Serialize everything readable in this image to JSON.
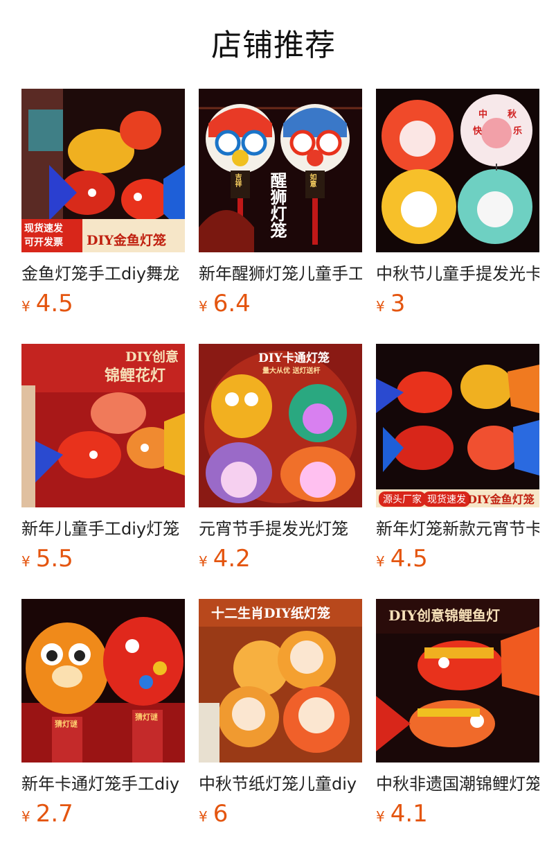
{
  "page_title": "店铺推荐",
  "currency": "¥",
  "colors": {
    "price": "#e4550f",
    "title": "#111111",
    "name": "#222222"
  },
  "products": [
    {
      "name": "金鱼灯笼手工diy舞龙",
      "price": "4.5",
      "image_text": {
        "tag_line1": "现货速发",
        "tag_line2": "可开发票",
        "banner": "DIY金鱼灯笼"
      }
    },
    {
      "name": "新年醒狮灯笼儿童手工",
      "price": "6.4",
      "image_text": {
        "left_plate": "吉祥",
        "right_plate": "如意",
        "vertical": "醒狮灯笼"
      }
    },
    {
      "name": "中秋节儿童手提发光卡",
      "price": "3",
      "image_text": {
        "lantern_text1": "中",
        "lantern_text2": "秋",
        "lantern_text3": "快",
        "lantern_text4": "乐"
      }
    },
    {
      "name": "新年儿童手工diy灯笼",
      "price": "5.5",
      "image_text": {
        "banner1": "DIY创意",
        "banner2": "锦鲤花灯"
      }
    },
    {
      "name": "元宵节手提发光灯笼",
      "price": "4.2",
      "image_text": {
        "banner": "DIY卡通灯笼",
        "sub_banner": "量大从优 送灯送杆"
      }
    },
    {
      "name": "新年灯笼新款元宵节卡",
      "price": "4.5",
      "image_text": {
        "tag1": "源头厂家",
        "tag2": "现货速发",
        "banner": "DIY金鱼灯笼"
      }
    },
    {
      "name": "新年卡通灯笼手工diy",
      "price": "2.7",
      "image_text": {
        "riddle1": "猜灯谜",
        "riddle2": "猜灯谜"
      }
    },
    {
      "name": "中秋节纸灯笼儿童diy",
      "price": "6",
      "image_text": {
        "banner": "十二生肖DIY纸灯笼"
      }
    },
    {
      "name": "中秋非遗国潮锦鲤灯笼",
      "price": "4.1",
      "image_text": {
        "banner": "DIY创意锦鲤鱼灯"
      }
    }
  ]
}
